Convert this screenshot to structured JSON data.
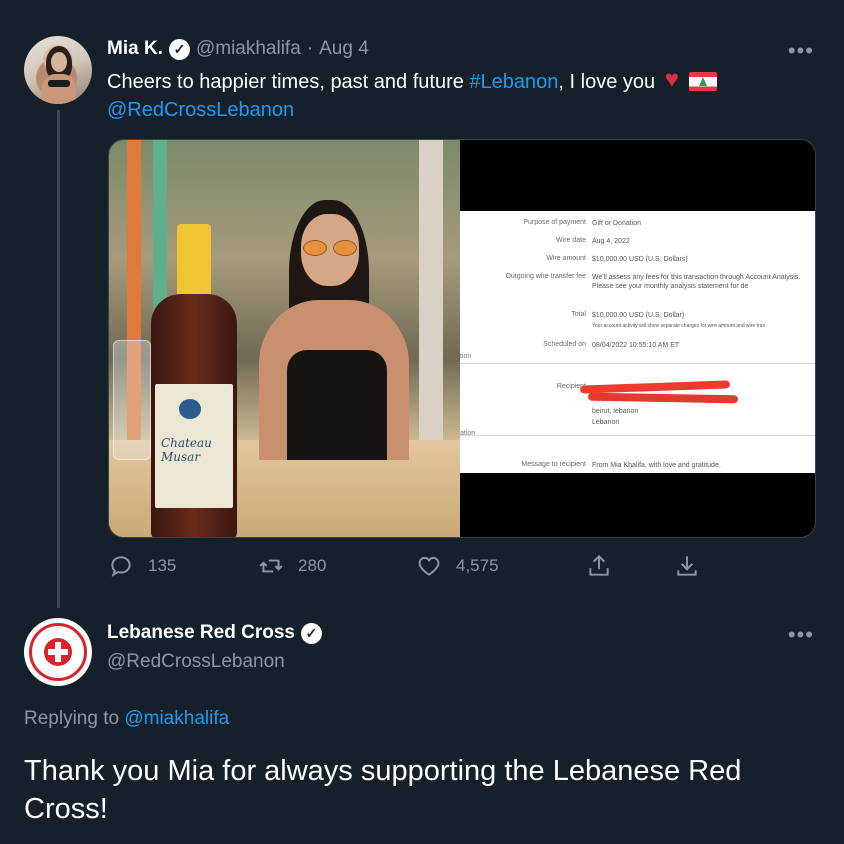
{
  "tweet": {
    "author_name": "Mia K.",
    "handle": "@miakhalifa",
    "separator": "·",
    "date": "Aug 4",
    "text_part1": "Cheers to happier times, past and future ",
    "hashtag": "#Lebanon",
    "text_part2": ", I love you",
    "mention": "@RedCrossLebanon",
    "more_label": "•••",
    "emoji": [
      "broken-heart-icon",
      "lebanon-flag-icon"
    ]
  },
  "media": {
    "bottle_label": "Chateau Musar",
    "receipt": {
      "purpose_label": "Purpose of payment",
      "purpose_value": "Gift or Donation",
      "wire_date_label": "Wire date",
      "wire_date_value": "Aug 4, 2022",
      "wire_amount_label": "Wire amount",
      "wire_amount_value": "$10,000.00 USD (U.S. Dollars)",
      "fee_label": "Outgoing wire transfer fee",
      "fee_value": "We'll assess any fees for this transaction through Account Analysis. Please see your monthly analysis statement for de",
      "total_label": "Total",
      "total_value": "$10,000.00 USD (U.S. Dollar)",
      "total_note": "Your account activity will show separate charges for wire amount and wire tran",
      "scheduled_label": "Scheduled on",
      "scheduled_value": "08/04/2022 10:55:10 AM ET",
      "recipient_label": "Recipient",
      "recipient_city": "beirut, lebanon",
      "recipient_country": "Lebanon",
      "message_label": "Message to recipient",
      "message_value": "From Mia Khalifa, with love and gratitude.",
      "edge_text_1": "tion",
      "edge_text_2": "ation"
    }
  },
  "actions": {
    "reply_count": "135",
    "retweet_count": "280",
    "like_count": "4,575"
  },
  "reply": {
    "author_name": "Lebanese Red Cross",
    "handle": "@RedCrossLebanon",
    "more_label": "•••",
    "replying_prefix": "Replying to ",
    "replying_handle": "@miakhalifa",
    "text": "Thank you Mia for always supporting the Lebanese Red Cross!"
  },
  "colors": {
    "background": "#15202b",
    "link": "#1d9bf0",
    "muted": "#8b98a5",
    "red_cross": "#d7242c"
  }
}
